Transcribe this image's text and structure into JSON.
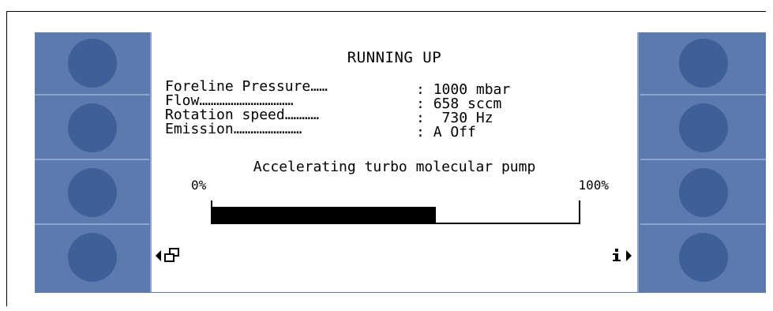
{
  "screen": {
    "title": "RUNNING UP",
    "rows": [
      {
        "label": "Foreline Pressure……",
        "sep": ": ",
        "value": "1000 mbar"
      },
      {
        "label": "Flow……………………………",
        "sep": ": ",
        "value": "658 sccm"
      },
      {
        "label": "Rotation speed…………",
        "sep": ": ",
        "value": " 730 Hz"
      },
      {
        "label": "Emission……………………",
        "sep": ": ",
        "value": "A Off"
      }
    ],
    "status_text": "Accelerating turbo molecular pump",
    "progress": {
      "min_label": "0%",
      "max_label": "100%",
      "value_fraction": 0.61
    }
  },
  "softkeys": {
    "left": [
      "",
      "",
      "",
      ""
    ],
    "right": [
      "",
      "",
      "",
      ""
    ]
  },
  "icons": {
    "nav_left": "arrow-left-window-icon",
    "nav_right": "info-arrow-right-icon"
  },
  "colors": {
    "panel": "#5c7aae",
    "key_circle": "#3f5f98"
  }
}
